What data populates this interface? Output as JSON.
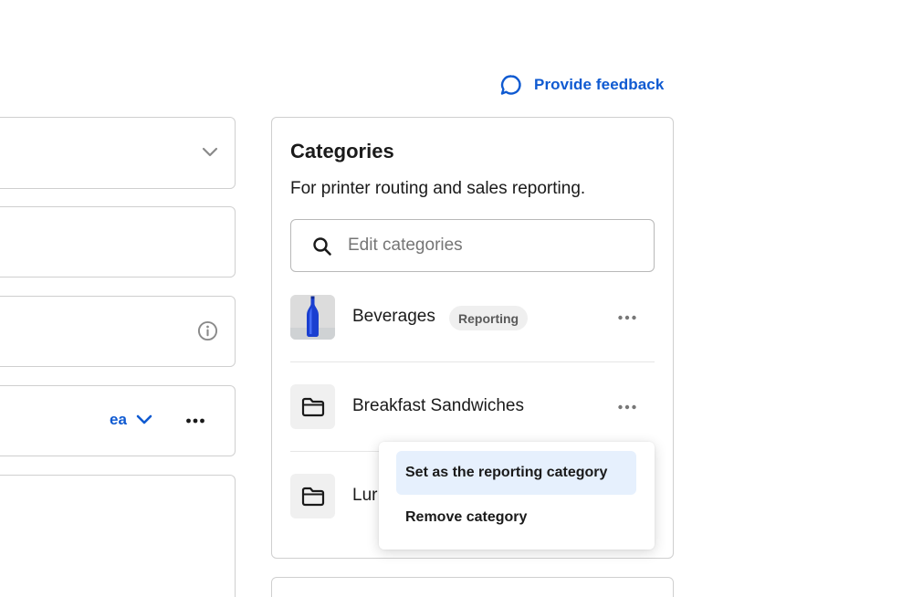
{
  "header": {
    "feedback_label": "Provide feedback",
    "feedback_icon": "speech-bubble-icon"
  },
  "left_column": {
    "unit_label": "ea",
    "icons": [
      "chevron-down-icon",
      "info-icon",
      "more-horizontal-icon"
    ]
  },
  "categories_panel": {
    "title": "Categories",
    "subtitle": "For printer routing and sales reporting.",
    "search": {
      "placeholder": "Edit categories",
      "value": ""
    },
    "items": [
      {
        "name": "Beverages",
        "badge": "Reporting",
        "thumbnail": "blue-bottle-image"
      },
      {
        "name": "Breakfast Sandwiches",
        "thumbnail": "folder-icon"
      },
      {
        "name": "Lur",
        "thumbnail": "folder-icon"
      }
    ]
  },
  "context_menu": {
    "items": [
      {
        "label": "Set as the reporting category",
        "highlighted": true
      },
      {
        "label": "Remove category",
        "highlighted": false
      }
    ]
  },
  "colors": {
    "accent": "#0f5ad1",
    "border": "#cfcfcf",
    "menu_highlight": "#e6f0fd",
    "badge_bg": "#efefef"
  }
}
